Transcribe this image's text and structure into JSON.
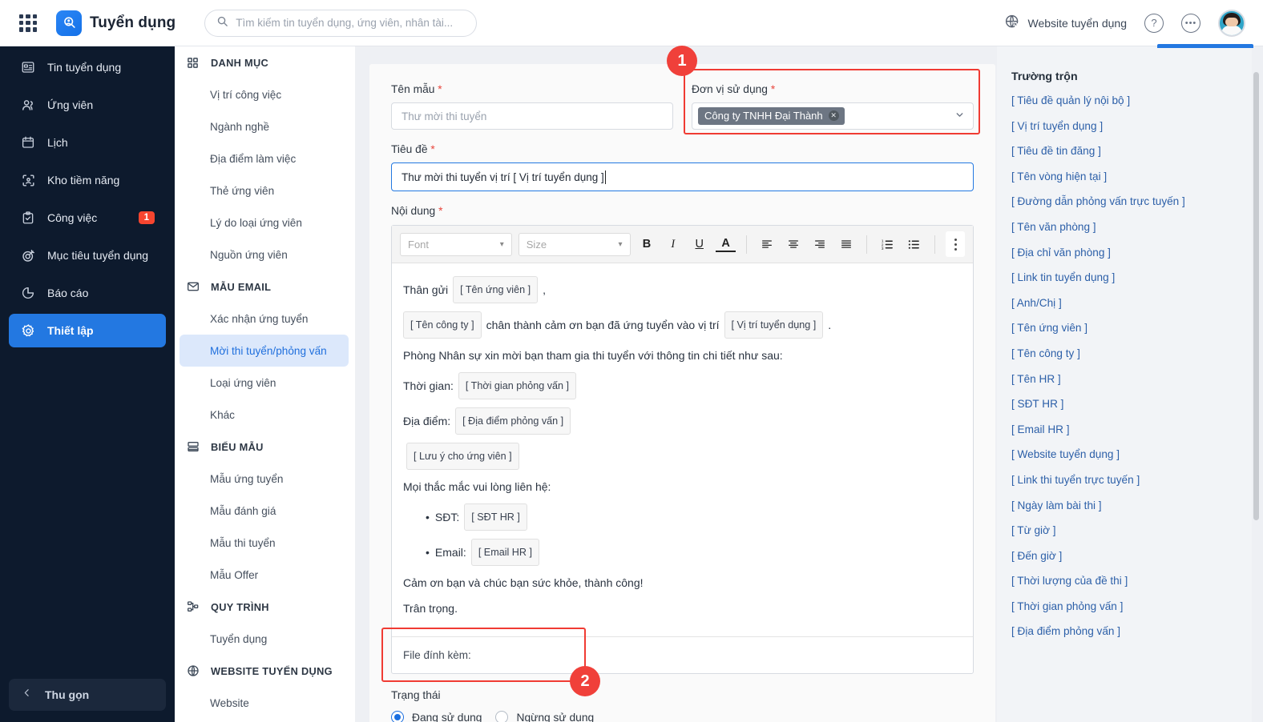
{
  "topbar": {
    "brand": "Tuyển dụng",
    "brand_icon": "user-search-icon",
    "apps_icon": "grid-apps-icon",
    "search_placeholder": "Tìm kiếm tin tuyển dụng, ứng viên, nhân tài...",
    "search_value": "",
    "search_icon": "search-icon",
    "website_link": "Website tuyển dụng",
    "website_icon": "globe-cursor-icon",
    "help_icon": "question-circle-icon",
    "more_icon": "ellipsis-circle-icon",
    "avatar_icon": "user-avatar"
  },
  "sidebar": {
    "items": [
      {
        "label": "Tin tuyển dụng",
        "icon": "news-icon",
        "badge": "",
        "active": false
      },
      {
        "label": "Ứng viên",
        "icon": "users-icon",
        "badge": "",
        "active": false
      },
      {
        "label": "Lịch",
        "icon": "calendar-icon",
        "badge": "",
        "active": false
      },
      {
        "label": "Kho tiềm năng",
        "icon": "talent-pool-icon",
        "badge": "",
        "active": false
      },
      {
        "label": "Công việc",
        "icon": "clipboard-check-icon",
        "badge": "1",
        "active": false
      },
      {
        "label": "Mục tiêu tuyển dụng",
        "icon": "target-icon",
        "badge": "",
        "active": false
      },
      {
        "label": "Báo cáo",
        "icon": "pie-chart-icon",
        "badge": "",
        "active": false
      },
      {
        "label": "Thiết lập",
        "icon": "gear-icon",
        "badge": "",
        "active": true
      }
    ],
    "collapse_label": "Thu gọn",
    "collapse_icon": "chevron-left-icon"
  },
  "subnav": {
    "groups": [
      {
        "title": "DANH MỤC",
        "icon": "category-grid-icon",
        "items": [
          {
            "label": "Vị trí công việc",
            "active": false
          },
          {
            "label": "Ngành nghề",
            "active": false
          },
          {
            "label": "Địa điểm làm việc",
            "active": false
          },
          {
            "label": "Thẻ ứng viên",
            "active": false
          },
          {
            "label": "Lý do loại ứng viên",
            "active": false
          },
          {
            "label": "Nguồn ứng viên",
            "active": false
          }
        ]
      },
      {
        "title": "MẪU EMAIL",
        "icon": "envelope-icon",
        "items": [
          {
            "label": "Xác nhận ứng tuyển",
            "active": false
          },
          {
            "label": "Mời thi tuyển/phỏng vấn",
            "active": true
          },
          {
            "label": "Loại ứng viên",
            "active": false
          },
          {
            "label": "Khác",
            "active": false
          }
        ]
      },
      {
        "title": "BIỂU MẪU",
        "icon": "form-icon",
        "items": [
          {
            "label": "Mẫu ứng tuyển",
            "active": false
          },
          {
            "label": "Mẫu đánh giá",
            "active": false
          },
          {
            "label": "Mẫu thi tuyển",
            "active": false
          },
          {
            "label": "Mẫu Offer",
            "active": false
          }
        ]
      },
      {
        "title": "QUY TRÌNH",
        "icon": "workflow-icon",
        "items": [
          {
            "label": "Tuyển dụng",
            "active": false
          }
        ]
      },
      {
        "title": "WEBSITE TUYỂN DỤNG",
        "icon": "globe-icon",
        "items": [
          {
            "label": "Website",
            "active": false
          }
        ]
      }
    ]
  },
  "form": {
    "template_name_label": "Tên mẫu",
    "template_name_placeholder": "Thư mời thi tuyển",
    "template_name_value": "",
    "unit_label": "Đơn vị sử dụng",
    "unit_chip": "Công ty TNHH Đại Thành",
    "unit_chip_remove_icon": "remove-chip-icon",
    "unit_caret_icon": "chevron-down-icon",
    "title_label": "Tiêu đề",
    "title_value": "Thư mời thi tuyển vị trí  [ Vị trí tuyển dụng ]",
    "content_label": "Nội dung",
    "required_mark": "*"
  },
  "editor": {
    "font_placeholder": "Font",
    "size_placeholder": "Size",
    "bold": "B",
    "italic": "I",
    "underline": "U",
    "textcolor": "A",
    "align_left_icon": "align-left-icon",
    "align_center_icon": "align-center-icon",
    "align_right_icon": "align-right-icon",
    "align_justify_icon": "align-justify-icon",
    "ordered_list_icon": "ordered-list-icon",
    "bullet_list_icon": "bullet-list-icon",
    "more_icon": "kebab-menu-icon",
    "body": {
      "greeting_prefix": "Thân gửi",
      "greeting_tag": "[ Tên ứng viên ]",
      "greeting_suffix": ",",
      "l2_tag1": "[ Tên công ty ]",
      "l2_mid": "chân thành cảm ơn bạn đã ứng tuyển vào vị trí",
      "l2_tag2": "[ Vị trí tuyển dụng ]",
      "l2_end": ".",
      "l3": "Phòng Nhân sự xin mời bạn tham gia thi tuyển với thông tin chi tiết như sau:",
      "time_label": "Thời gian:",
      "time_tag": "[ Thời gian phỏng vấn ]",
      "place_label": "Địa điểm:",
      "place_tag": "[ Địa điểm phỏng vấn ]",
      "note_tag": "[ Lưu ý cho ứng viên ]",
      "contact_intro": "Mọi thắc mắc vui lòng liên hệ:",
      "phone_label": "SĐT:",
      "phone_tag": "[ SĐT HR ]",
      "email_label": "Email:",
      "email_tag": "[ Email HR ]",
      "thanks": "Cảm ơn bạn và chúc bạn sức khỏe, thành công!",
      "regards": "Trân trọng.",
      "attach_label": "File đính kèm:"
    }
  },
  "status": {
    "title": "Trạng thái",
    "option_active": "Đang sử dụng",
    "option_inactive": "Ngừng sử dụng",
    "selected": "Đang sử dụng"
  },
  "merge_panel": {
    "title": "Trường trộn",
    "fields": [
      "[ Tiêu đề quản lý nội bộ ]",
      "[ Vị trí tuyển dụng ]",
      "[ Tiêu đề tin đăng ]",
      "[ Tên vòng hiện tại ]",
      "[ Đường dẫn phỏng vấn trực tuyến ]",
      "[ Tên văn phòng ]",
      "[ Địa chỉ văn phòng ]",
      "[ Link tin tuyển dụng ]",
      "[ Anh/Chị ]",
      "[ Tên ứng viên ]",
      "[ Tên công ty ]",
      "[ Tên HR ]",
      "[ SĐT HR ]",
      "[ Email HR ]",
      "[ Website tuyển dụng ]",
      "[ Link thi tuyển trực tuyến ]",
      "[ Ngày làm bài thi ]",
      "[ Từ giờ ]",
      "[ Đến giờ ]",
      "[ Thời lượng của đề thi ]",
      "[ Thời gian phỏng vấn ]",
      "[ Địa điểm phỏng vấn ]"
    ]
  },
  "annotations": {
    "callout_1": "1",
    "callout_2": "2",
    "highlight_color": "#f03b33"
  }
}
